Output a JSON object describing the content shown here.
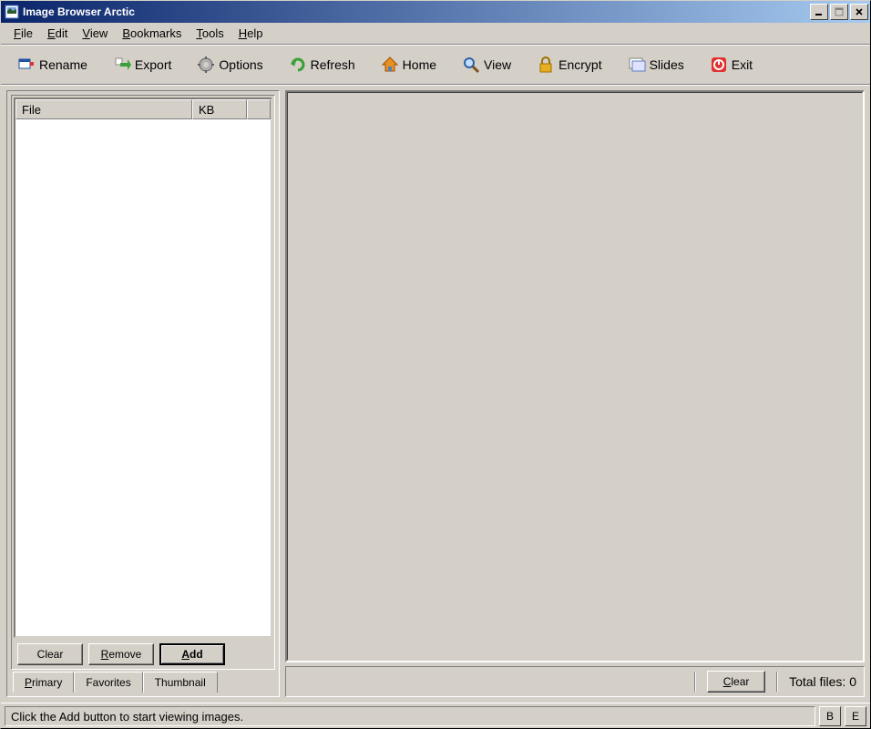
{
  "title": "Image Browser Arctic",
  "menus": {
    "file": "File",
    "edit": "Edit",
    "view": "View",
    "bookmarks": "Bookmarks",
    "tools": "Tools",
    "help": "Help"
  },
  "toolbar": {
    "rename": "Rename",
    "export": "Export",
    "options": "Options",
    "refresh": "Refresh",
    "home": "Home",
    "view": "View",
    "encrypt": "Encrypt",
    "slides": "Slides",
    "exit": "Exit"
  },
  "list": {
    "col_file": "File",
    "col_kb": "KB"
  },
  "buttons": {
    "clear": "Clear",
    "remove": "Remove",
    "add": "Add"
  },
  "tabs": {
    "primary": "Primary",
    "favorites": "Favorites",
    "thumbnail": "Thumbnail"
  },
  "right": {
    "clear": "Clear",
    "total": "Total files:  0"
  },
  "status": {
    "text": "Click the Add button to start viewing images.",
    "b": "B",
    "e": "E"
  }
}
